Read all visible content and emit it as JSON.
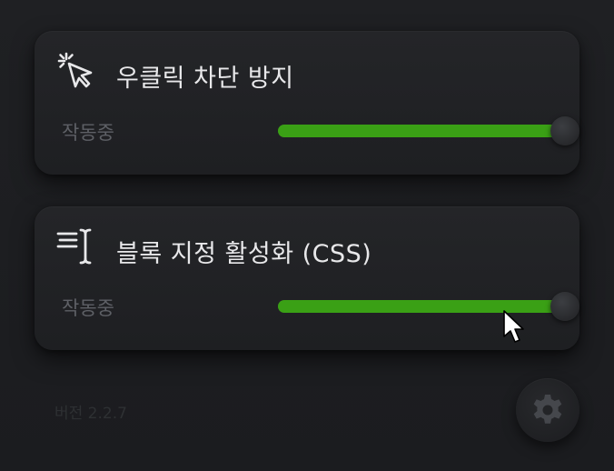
{
  "cards": [
    {
      "icon": "cursor-click-icon",
      "title": "우클릭 차단 방지",
      "status": "작동중",
      "enabled": 1.0
    },
    {
      "icon": "text-select-icon",
      "title": "블록 지정 활성화 (CSS)",
      "status": "작동중",
      "enabled": 1.0
    }
  ],
  "version": "버전 2.2.7",
  "colors": {
    "accent": "#3aa015",
    "background": "#1d1e21",
    "card": "#232427",
    "title_text": "#e8e8ea",
    "muted_text": "#5e6066"
  },
  "settings_icon": "gear-icon"
}
